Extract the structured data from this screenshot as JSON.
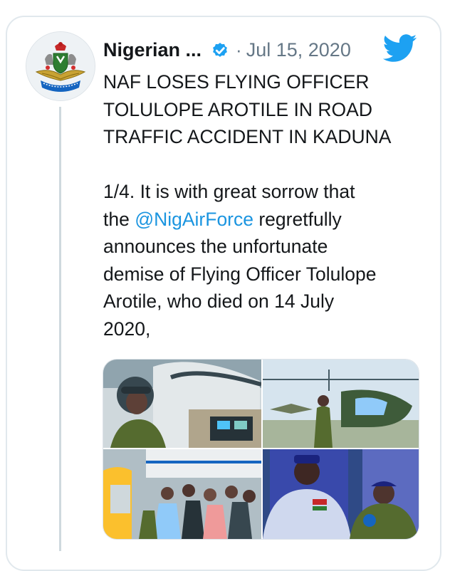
{
  "tweet": {
    "author_name": "Nigerian ...",
    "separator": "·",
    "date": "Jul 15, 2020",
    "headline_lines": [
      "NAF LOSES FLYING OFFICER",
      "TOLULOPE AROTILE IN ROAD",
      "TRAFFIC ACCIDENT IN KADUNA"
    ],
    "body_line1": "1/4.   It is with great sorrow that",
    "body_prefix": "the ",
    "mention": "@NigAirForce",
    "body_suffix": " regretfully",
    "body_lines": [
      "announces the unfortunate",
      "demise of Flying Officer Tolulope",
      "Arotile, who died on 14 July",
      "2020,"
    ]
  },
  "avatar": {
    "icon": "nigerian-air-force-crest",
    "crest_text": "NIGERIAN AIR FORCE"
  },
  "icons": {
    "verified": "verified-badge-icon",
    "platform": "twitter-bird-icon"
  },
  "media": {
    "photos": [
      "photo-pilot-in-cockpit",
      "photo-officer-with-helicopter",
      "photo-crowd-at-event",
      "photo-officers-portrait"
    ]
  },
  "colors": {
    "text": "#14171a",
    "muted": "#657786",
    "link": "#1b95e0",
    "brand": "#1da1f2",
    "border": "#e1e8ed"
  }
}
